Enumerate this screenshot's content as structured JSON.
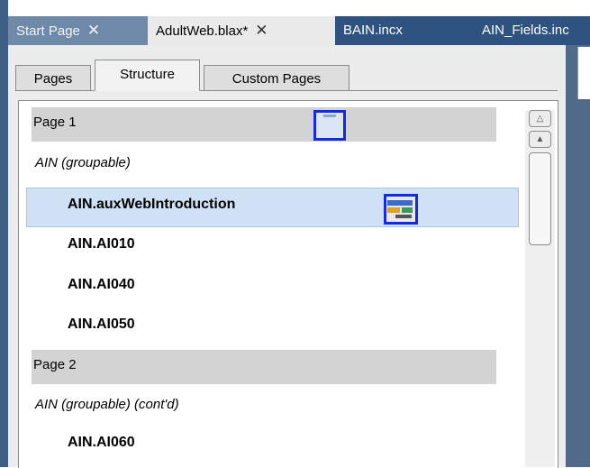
{
  "tabs": [
    {
      "label": "Start Page",
      "close": "✕"
    },
    {
      "label": "AdultWeb.blax*",
      "close": "✕"
    },
    {
      "label": "BAIN.incx"
    },
    {
      "label": "AIN_Fields.inc"
    }
  ],
  "subtabs": [
    "Pages",
    "Structure",
    "Custom Pages"
  ],
  "tree": {
    "page1": "Page 1",
    "group1": "AIN (groupable)",
    "selected_item": "AIN.auxWebIntroduction",
    "items1": [
      "AIN.AI010",
      "AIN.AI040",
      "AIN.AI050"
    ],
    "page2": "Page 2",
    "group2": "AIN (groupable) (cont'd)",
    "items2": [
      "AIN.AI060"
    ]
  },
  "scrollbar": {
    "top_icon": "double-up-arrow",
    "up_icon": "up-arrow"
  },
  "colors": {
    "tab_bar": "#2f5380",
    "active_tab": "#eaeaea",
    "selected_row": "#cfe1f5",
    "page_row": "#d3d3d3",
    "thumbnail_border": "#1429e0"
  }
}
